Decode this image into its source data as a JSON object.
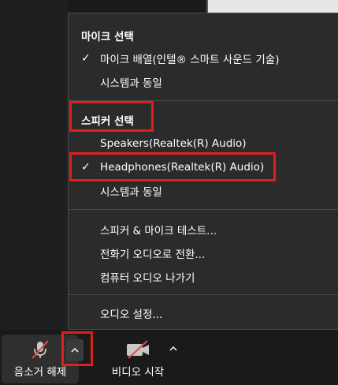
{
  "menu": {
    "mic_header": "마이크 선택",
    "mic_items": [
      {
        "label": "마이크 배열(인텔® 스마트 사운드 기술)",
        "checked": true
      },
      {
        "label": "시스템과 동일",
        "checked": false
      }
    ],
    "speaker_header": "스피커 선택",
    "speaker_items": [
      {
        "label": "Speakers(Realtek(R) Audio)",
        "checked": false
      },
      {
        "label": "Headphones(Realtek(R) Audio)",
        "checked": true
      },
      {
        "label": "시스템과 동일",
        "checked": false
      }
    ],
    "actions": [
      "스피커 & 마이크 테스트...",
      "전화기 오디오로 전환...",
      "컴퓨터 오디오 나가기"
    ],
    "settings": "오디오 설정...",
    "check_glyph": "✓"
  },
  "toolbar": {
    "mic_label": "음소거 해제",
    "mic_icon": "muted-mic-icon",
    "video_label": "비디오 시작",
    "video_icon": "video-off-icon",
    "caret_icon": "chevron-up-icon"
  },
  "colors": {
    "highlight": "#e01e1e",
    "menu_bg": "#2b2b2b",
    "mute_slash": "#e5484d"
  }
}
